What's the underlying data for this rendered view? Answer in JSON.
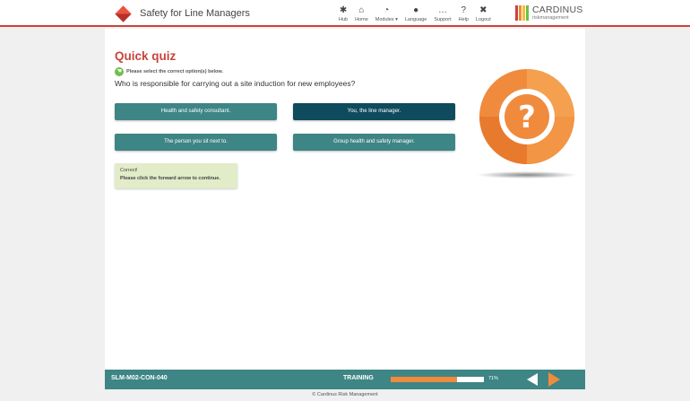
{
  "header": {
    "app_title": "Safety for Line Managers",
    "nav": [
      {
        "label": "Hub",
        "icon": "hub-icon",
        "glyph": "✱"
      },
      {
        "label": "Home",
        "icon": "home-icon",
        "glyph": "⌂"
      },
      {
        "label": "Modules ▾",
        "icon": "gauge-icon",
        "glyph": "◔"
      },
      {
        "label": "Language",
        "icon": "globe-icon",
        "glyph": "●"
      },
      {
        "label": "Support",
        "icon": "chat-icon",
        "glyph": "…"
      },
      {
        "label": "Help",
        "icon": "question-icon",
        "glyph": "?"
      },
      {
        "label": "Logout",
        "icon": "close-icon",
        "glyph": "✖"
      }
    ],
    "logo_main": "CARDINUS",
    "logo_sub": "riskmanagement"
  },
  "quiz": {
    "title": "Quick quiz",
    "instruction": "Please select the correct option(s) below.",
    "question": "Who is responsible for carrying out a site induction for new employees?",
    "options": [
      {
        "label": "Health and safety consultant.",
        "selected": false
      },
      {
        "label": "You, the line manager.",
        "selected": true
      },
      {
        "label": "The person you sit next to.",
        "selected": false
      },
      {
        "label": "Group health and safety manager.",
        "selected": false
      }
    ],
    "feedback_line1": "Correct!",
    "feedback_line2": "Please click the forward arrow to continue."
  },
  "footer": {
    "code": "SLM-M02-CON-040",
    "mode": "TRAINING",
    "progress": 71,
    "progress_label": "71%",
    "copyright": "© Cardinus Risk Management"
  },
  "colors": {
    "accent_red": "#c9443a",
    "teal": "#3e8585",
    "dark_teal": "#0e4b5c",
    "orange": "#f08b3e",
    "feedback_bg": "#e2ecc9"
  }
}
